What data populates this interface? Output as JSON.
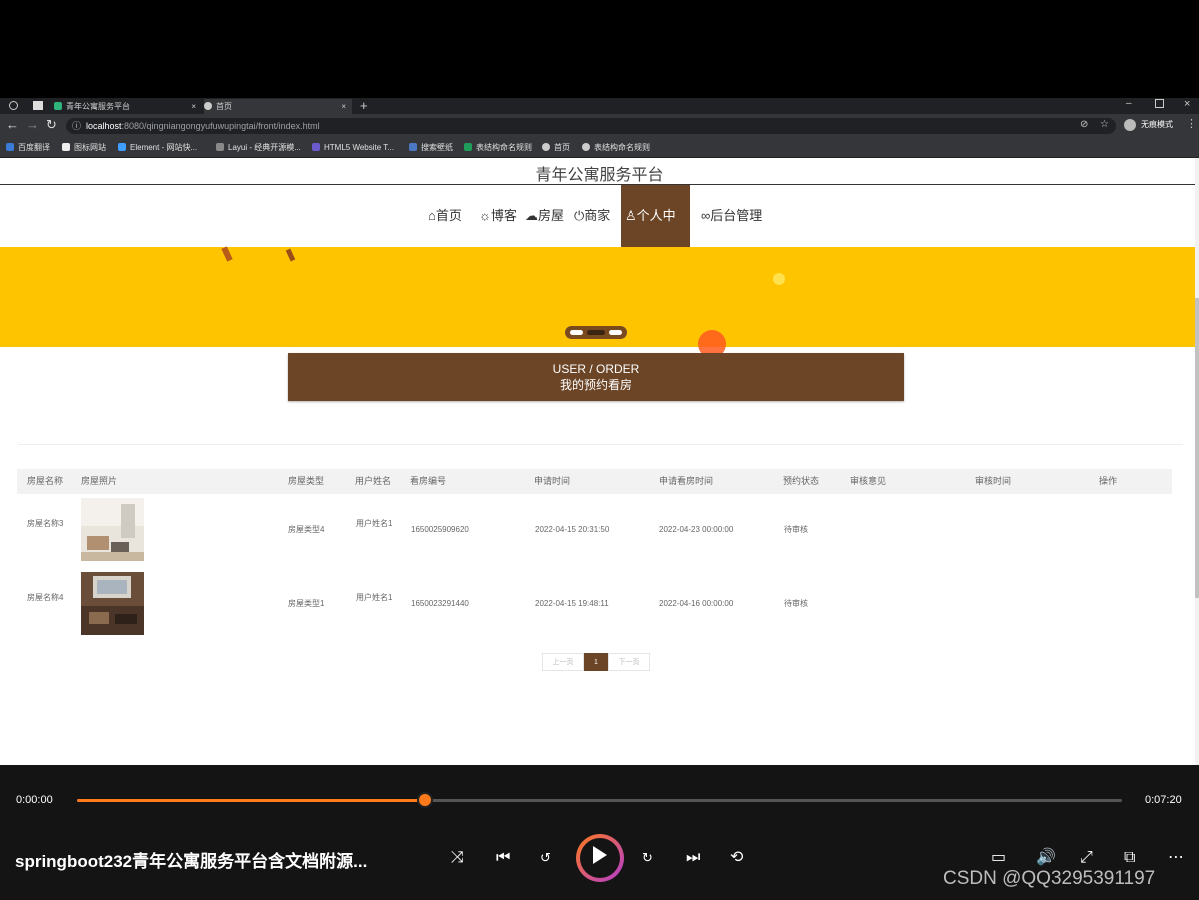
{
  "browser": {
    "tabs": [
      {
        "label": "青年公寓服务平台"
      },
      {
        "label": "首页"
      }
    ],
    "url_host": "localhost",
    "url_path": ":8080/qingniangongyufuwupingtai/front/index.html",
    "profile_label": "无痕模式",
    "bookmarks": [
      "百度翻译",
      "图标网站",
      "Element - 网站快...",
      "Layui - 经典开源模...",
      "HTML5 Website T...",
      "搜索壁纸",
      "表结构命名规则",
      "首页",
      "表结构命名规则"
    ]
  },
  "site": {
    "title": "青年公寓服务平台",
    "nav": [
      "首页",
      "博客",
      "房屋",
      "商家",
      "个人中心",
      "后台管理"
    ],
    "nav_icons": [
      "home-icon",
      "gear-icon",
      "cloud-icon",
      "power-icon",
      "user-icon",
      "link-icon"
    ],
    "active_nav": "个人中心",
    "banner_color": "#ffc400",
    "accent_color": "#6b4526",
    "section_en": "USER / ORDER",
    "section_cn": "我的预约看房"
  },
  "table": {
    "headers": [
      "房屋名称",
      "房屋照片",
      "房屋类型",
      "用户姓名",
      "看房编号",
      "申请时间",
      "申请看房时间",
      "预约状态",
      "审核意见",
      "审核时间",
      "操作"
    ],
    "rows": [
      {
        "name": "房屋名称3",
        "type": "房屋类型4",
        "user": "用户姓名1",
        "code": "1650025909620",
        "apply_time": "2022-04-15 20:31:50",
        "view_time": "2022-04-23 00:00:00",
        "status": "待审核",
        "opinion": "",
        "review_time": "",
        "action": ""
      },
      {
        "name": "房屋名称4",
        "type": "房屋类型1",
        "user": "用户姓名1",
        "code": "1650023291440",
        "apply_time": "2022-04-15 19:48:11",
        "view_time": "2022-04-16 00:00:00",
        "status": "待审核",
        "opinion": "",
        "review_time": "",
        "action": ""
      }
    ]
  },
  "pagination": {
    "prev": "上一页",
    "current": "1",
    "next": "下一页"
  },
  "player": {
    "current_time": "0:00:00",
    "total_time": "0:07:20",
    "progress": 0.333,
    "title": "springboot232青年公寓服务平台含文档附源...",
    "watermark": "CSDN @QQ3295391197",
    "accent_color": "#ff7a1a"
  }
}
